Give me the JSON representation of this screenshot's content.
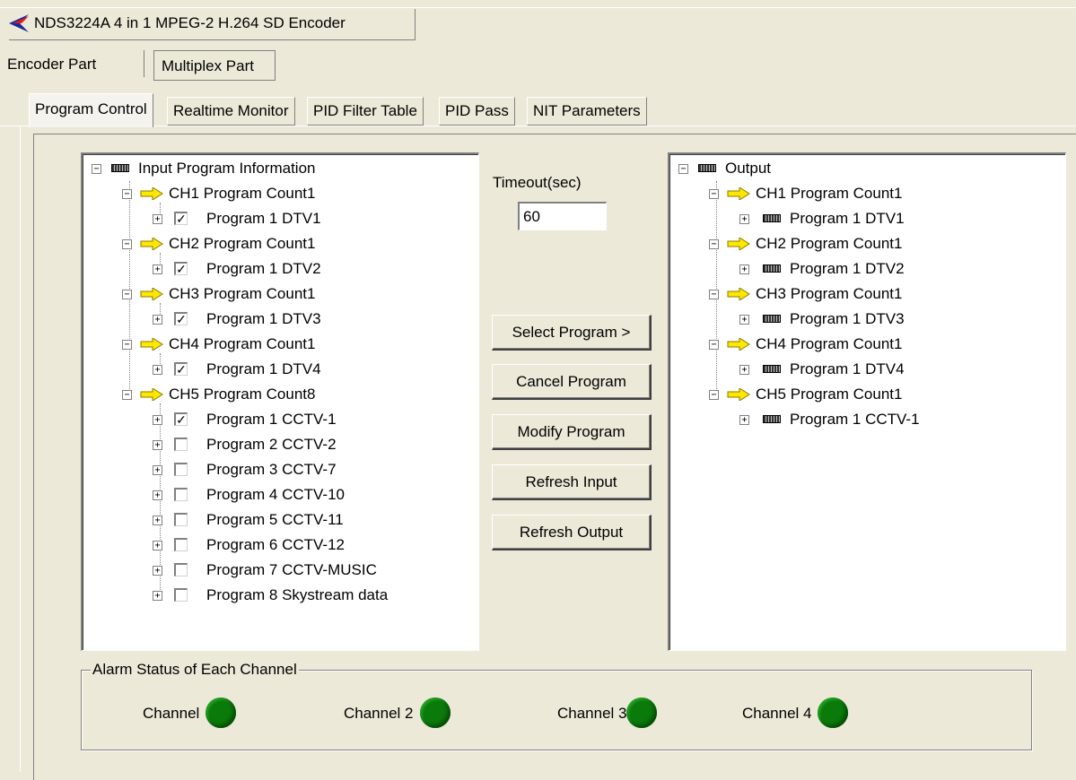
{
  "window": {
    "title": "NDS3224A 4 in 1 MPEG-2 H.264 SD Encoder"
  },
  "part_tabs": [
    "Encoder Part",
    "Multiplex Part"
  ],
  "sub_tabs": [
    "Program Control",
    "Realtime Monitor",
    "PID Filter Table",
    "PID Pass",
    "NIT Parameters"
  ],
  "input_tree": {
    "root": "Input Program Information",
    "channels": [
      {
        "label": "CH1 Program Count1",
        "programs": [
          {
            "label": "Program 1 DTV1",
            "checked": true
          }
        ]
      },
      {
        "label": "CH2 Program Count1",
        "programs": [
          {
            "label": "Program 1 DTV2",
            "checked": true
          }
        ]
      },
      {
        "label": "CH3 Program Count1",
        "programs": [
          {
            "label": "Program 1 DTV3",
            "checked": true
          }
        ]
      },
      {
        "label": "CH4 Program Count1",
        "programs": [
          {
            "label": "Program 1 DTV4",
            "checked": true
          }
        ]
      },
      {
        "label": "CH5 Program Count8",
        "programs": [
          {
            "label": "Program 1 CCTV-1",
            "checked": true
          },
          {
            "label": "Program 2 CCTV-2",
            "checked": false
          },
          {
            "label": "Program 3 CCTV-7",
            "checked": false
          },
          {
            "label": "Program 4 CCTV-10",
            "checked": false
          },
          {
            "label": "Program 5 CCTV-11",
            "checked": false
          },
          {
            "label": "Program 6 CCTV-12",
            "checked": false
          },
          {
            "label": "Program 7 CCTV-MUSIC",
            "checked": false
          },
          {
            "label": "Program 8 Skystream data",
            "checked": false
          }
        ]
      }
    ]
  },
  "timeout": {
    "label": "Timeout(sec)",
    "value": "60"
  },
  "buttons": {
    "select": "Select Program >",
    "cancel": "Cancel Program",
    "modify": "Modify Program",
    "refresh_input": "Refresh Input",
    "refresh_output": "Refresh Output"
  },
  "output_tree": {
    "root": "Output",
    "channels": [
      {
        "label": "CH1 Program Count1",
        "programs": [
          "Program 1 DTV1"
        ]
      },
      {
        "label": "CH2 Program Count1",
        "programs": [
          "Program 1 DTV2"
        ]
      },
      {
        "label": "CH3 Program Count1",
        "programs": [
          "Program 1 DTV3"
        ]
      },
      {
        "label": "CH4 Program Count1",
        "programs": [
          "Program 1 DTV4"
        ]
      },
      {
        "label": "CH5 Program Count1",
        "programs": [
          "Program 1 CCTV-1"
        ]
      }
    ]
  },
  "alarm": {
    "title": "Alarm Status of Each Channel",
    "channels": [
      {
        "label": "Channel",
        "status_color": "#0a7a0a"
      },
      {
        "label": "Channel 2",
        "status_color": "#0a7a0a"
      },
      {
        "label": "Channel 3",
        "status_color": "#0a7a0a"
      },
      {
        "label": "Channel 4",
        "status_color": "#0a7a0a"
      }
    ]
  },
  "colors": {
    "led_ok": "#0a7a0a",
    "arrow_fill": "#ffe800"
  }
}
